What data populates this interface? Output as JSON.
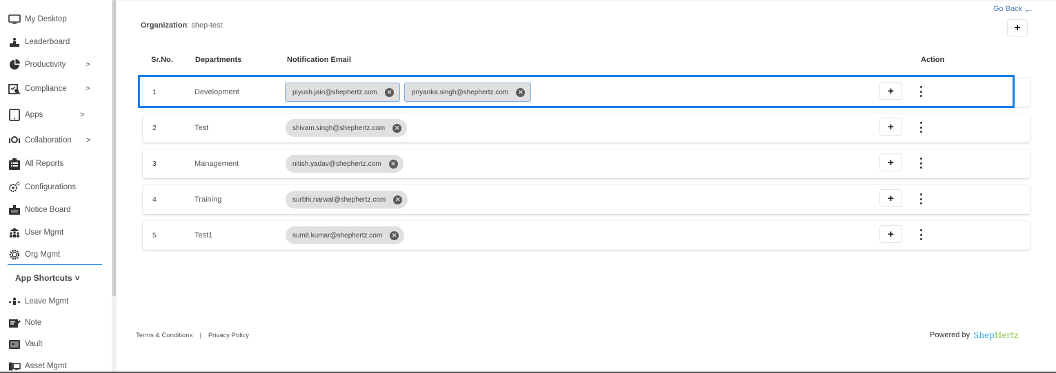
{
  "sidebar": {
    "items": [
      {
        "label": "My Desktop",
        "icon": "monitor-icon",
        "chevron": ""
      },
      {
        "label": "Leaderboard",
        "icon": "leaderboard-icon",
        "chevron": ""
      },
      {
        "label": "Productivity",
        "icon": "pie-chart-icon",
        "chevron": ">"
      },
      {
        "label": "Compliance",
        "icon": "compliance-icon",
        "chevron": ">"
      },
      {
        "label": "Apps",
        "icon": "tablet-icon",
        "chevron": ">"
      },
      {
        "label": "Collaboration",
        "icon": "collaboration-icon",
        "chevron": ">"
      },
      {
        "label": "All Reports",
        "icon": "clipboard-icon",
        "chevron": ""
      },
      {
        "label": "Configurations",
        "icon": "gears-icon",
        "chevron": ""
      },
      {
        "label": "Notice Board",
        "icon": "notice-board-icon",
        "chevron": ""
      },
      {
        "label": "User Mgmt",
        "icon": "users-icon",
        "chevron": ""
      },
      {
        "label": "Org Mgmt",
        "icon": "org-gear-icon",
        "chevron": ""
      }
    ],
    "shortcuts_title": "App Shortcuts",
    "shortcuts_chevron": "˅",
    "shortcuts": [
      {
        "label": "Leave Mgmt",
        "icon": "leave-icon"
      },
      {
        "label": "Note",
        "icon": "note-icon"
      },
      {
        "label": "Vault",
        "icon": "vault-icon"
      },
      {
        "label": "Asset Mgmt",
        "icon": "asset-icon"
      }
    ]
  },
  "header": {
    "org_label": "Organization",
    "org_value": ": shep-test",
    "go_back": "Go Back",
    "go_back_arrow": "←",
    "add_button": "+"
  },
  "table": {
    "columns": [
      "Sr.No.",
      "Departments",
      "Notification Email",
      "Action"
    ],
    "rows": [
      {
        "sr": "1",
        "department": "Development",
        "emails": [
          "piyush.jain@shephertz.com",
          "priyanka.singh@shephertz.com"
        ],
        "selected": true
      },
      {
        "sr": "2",
        "department": "Test",
        "emails": [
          "shivam.singh@shephertz.com"
        ],
        "selected": false
      },
      {
        "sr": "3",
        "department": "Management",
        "emails": [
          "nitish.yadav@shephertz.com"
        ],
        "selected": false
      },
      {
        "sr": "4",
        "department": "Training",
        "emails": [
          "surbhi.narwal@shephertz.com"
        ],
        "selected": false
      },
      {
        "sr": "5",
        "department": "Test1",
        "emails": [
          "sumit.kumar@shephertz.com"
        ],
        "selected": false
      }
    ],
    "row_add_label": "+",
    "chip_remove_label": "✕"
  },
  "footer": {
    "terms": "Terms & Conditions",
    "separator": "|",
    "privacy": "Privacy Policy",
    "powered_by": "Powered by",
    "brand_part1": "Shep",
    "brand_part2": "Hertz"
  },
  "colors": {
    "accent": "#1a7fe6",
    "chip_bg": "#e0e0e0",
    "brand_blue": "#38a8e4",
    "brand_green": "#8cc94e",
    "link": "#4a7ab5"
  }
}
